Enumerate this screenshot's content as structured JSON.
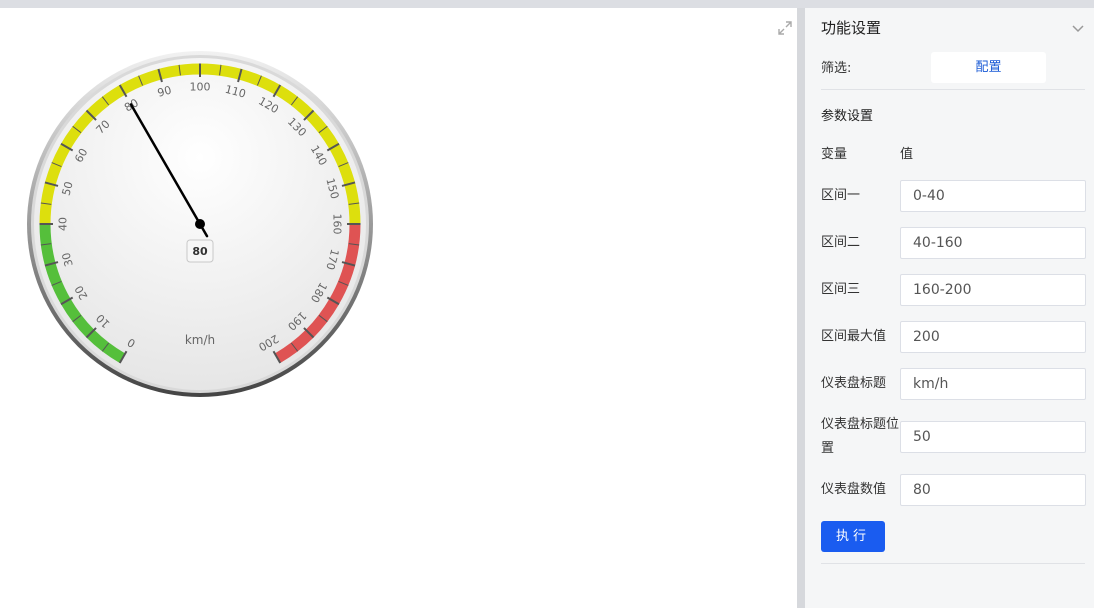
{
  "panel": {
    "title": "功能设置",
    "filter_label": "筛选:",
    "config_button": "配置",
    "params_title": "参数设置",
    "col_variable": "变量",
    "col_value": "值",
    "rows": [
      {
        "label": "区间一",
        "value": "0-40"
      },
      {
        "label": "区间二",
        "value": "40-160"
      },
      {
        "label": "区间三",
        "value": "160-200"
      },
      {
        "label": "区间最大值",
        "value": "200"
      },
      {
        "label": "仪表盘标题",
        "value": "km/h"
      },
      {
        "label": "仪表盘标题位置",
        "value": "50"
      },
      {
        "label": "仪表盘数值",
        "value": "80"
      }
    ],
    "run_button": "执行"
  },
  "chart_data": {
    "type": "gauge",
    "min": 0,
    "max": 200,
    "value": 80,
    "value_label": "80",
    "title": "km/h",
    "tick_step": 10,
    "tick_labels": [
      "0",
      "10",
      "20",
      "30",
      "40",
      "50",
      "60",
      "70",
      "80",
      "90",
      "100",
      "110",
      "120",
      "130",
      "140",
      "150",
      "160",
      "170",
      "180",
      "190",
      "200"
    ],
    "bands": [
      {
        "from": 0,
        "to": 40,
        "color": "#55bf3b"
      },
      {
        "from": 40,
        "to": 160,
        "color": "#dddf0d"
      },
      {
        "from": 160,
        "to": 200,
        "color": "#df5353"
      }
    ]
  }
}
